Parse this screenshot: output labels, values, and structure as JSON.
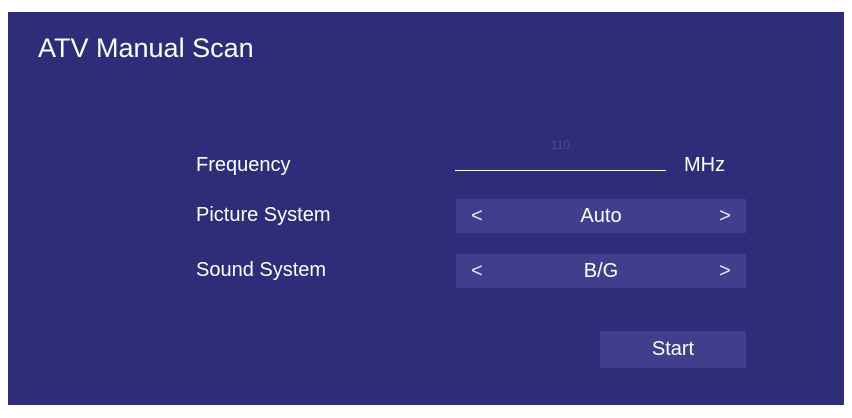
{
  "title": "ATV Manual Scan",
  "frequency": {
    "label": "Frequency",
    "value": "110",
    "unit": "MHz"
  },
  "picture_system": {
    "label": "Picture System",
    "value": "Auto",
    "prev_icon": "chevron-left",
    "next_icon": "chevron-right"
  },
  "sound_system": {
    "label": "Sound System",
    "value": "B/G",
    "prev_icon": "chevron-left",
    "next_icon": "chevron-right"
  },
  "start_label": "Start",
  "colors": {
    "background": "#2d2d79",
    "control": "#3f3f8d",
    "text": "#ffffff"
  }
}
